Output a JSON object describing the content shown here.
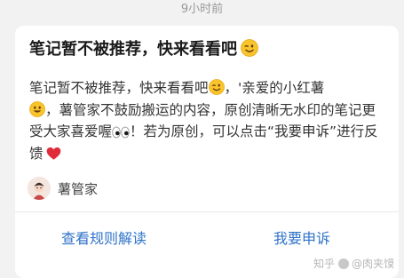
{
  "timestamp": "9小时前",
  "card": {
    "title": "笔记暂不被推荐，快来看看吧",
    "body_part1": "笔记暂不被推荐，快来看看吧",
    "body_part2": "，'亲爱的小红薯",
    "body_part3": "，薯管家不鼓励搬运的内容，原创清晰无水印的笔记更受大家喜爱喔",
    "body_part4": "！若为原创，可以点击“我要申诉”进行反馈",
    "author": "薯管家",
    "actions": {
      "view_rules": "查看规则解读",
      "appeal": "我要申诉"
    }
  },
  "watermark": {
    "site": "知乎",
    "user": "@肉夹馍"
  },
  "icons": {
    "wink": "wink-emoji-icon",
    "smile": "smile-emoji-icon",
    "eyes": "eyes-emoji-icon",
    "heart": "red-heart-emoji-icon",
    "avatar": "shuguanjia-avatar-icon"
  },
  "colors": {
    "link": "#2f73c8",
    "heart": "#e02b3b",
    "emoji": "#f7c52b"
  }
}
